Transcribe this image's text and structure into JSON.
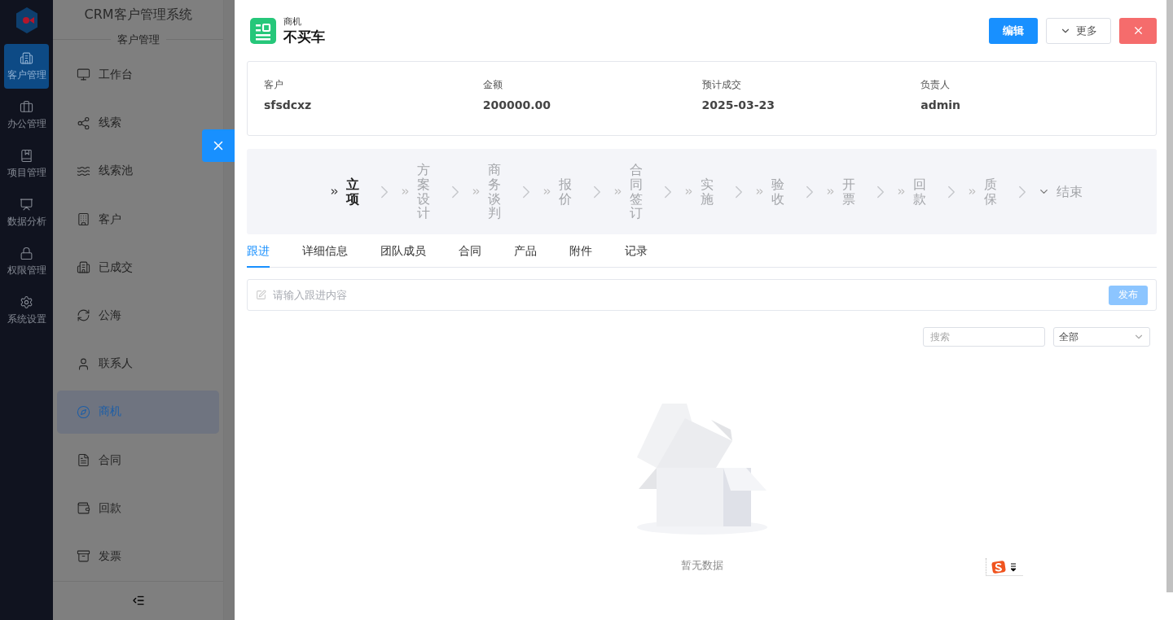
{
  "rail": {
    "items": [
      {
        "label": "客户管理",
        "selected": true
      },
      {
        "label": "办公管理",
        "selected": false
      },
      {
        "label": "项目管理",
        "selected": false
      },
      {
        "label": "数据分析",
        "selected": false
      },
      {
        "label": "权限管理",
        "selected": false
      },
      {
        "label": "系统设置",
        "selected": false
      }
    ]
  },
  "menu": {
    "title": "CRM客户管理系统",
    "section": "客户管理",
    "items": [
      {
        "label": "工作台",
        "selected": false
      },
      {
        "label": "线索",
        "selected": false
      },
      {
        "label": "线索池",
        "selected": false
      },
      {
        "label": "客户",
        "selected": false
      },
      {
        "label": "已成交",
        "selected": false
      },
      {
        "label": "公海",
        "selected": false
      },
      {
        "label": "联系人",
        "selected": false
      },
      {
        "label": "商机",
        "selected": true
      },
      {
        "label": "合同",
        "selected": false
      },
      {
        "label": "回款",
        "selected": false
      },
      {
        "label": "发票",
        "selected": false
      }
    ]
  },
  "drawer": {
    "type_label": "商机",
    "title": "不买车",
    "edit": "编辑",
    "more": "更多",
    "info": [
      {
        "label": "客户",
        "value": "sfsdcxz"
      },
      {
        "label": "金额",
        "value": "200000.00"
      },
      {
        "label": "预计成交",
        "value": "2025-03-23"
      },
      {
        "label": "负责人",
        "value": "admin"
      }
    ],
    "stages": [
      {
        "label": "立项",
        "selected": true,
        "kind": "step"
      },
      {
        "label": "方案设计",
        "selected": false,
        "kind": "step"
      },
      {
        "label": "商务谈判",
        "selected": false,
        "kind": "step"
      },
      {
        "label": "报价",
        "selected": false,
        "kind": "step"
      },
      {
        "label": "合同签订",
        "selected": false,
        "kind": "step"
      },
      {
        "label": "实施",
        "selected": false,
        "kind": "step"
      },
      {
        "label": "验收",
        "selected": false,
        "kind": "step"
      },
      {
        "label": "开票",
        "selected": false,
        "kind": "step"
      },
      {
        "label": "回款",
        "selected": false,
        "kind": "step"
      },
      {
        "label": "质保",
        "selected": false,
        "kind": "step"
      },
      {
        "label": "结束",
        "selected": false,
        "kind": "end"
      }
    ],
    "tabs": [
      {
        "label": "跟进",
        "selected": true
      },
      {
        "label": "详细信息",
        "selected": false
      },
      {
        "label": "团队成员",
        "selected": false
      },
      {
        "label": "合同",
        "selected": false
      },
      {
        "label": "产品",
        "selected": false
      },
      {
        "label": "附件",
        "selected": false
      },
      {
        "label": "记录",
        "selected": false
      }
    ],
    "composer": {
      "placeholder": "请输入跟进内容",
      "submit": "发布",
      "disabled": true
    },
    "filters": {
      "search_placeholder": "搜索",
      "select_value": "全部"
    },
    "empty": "暂无数据"
  }
}
